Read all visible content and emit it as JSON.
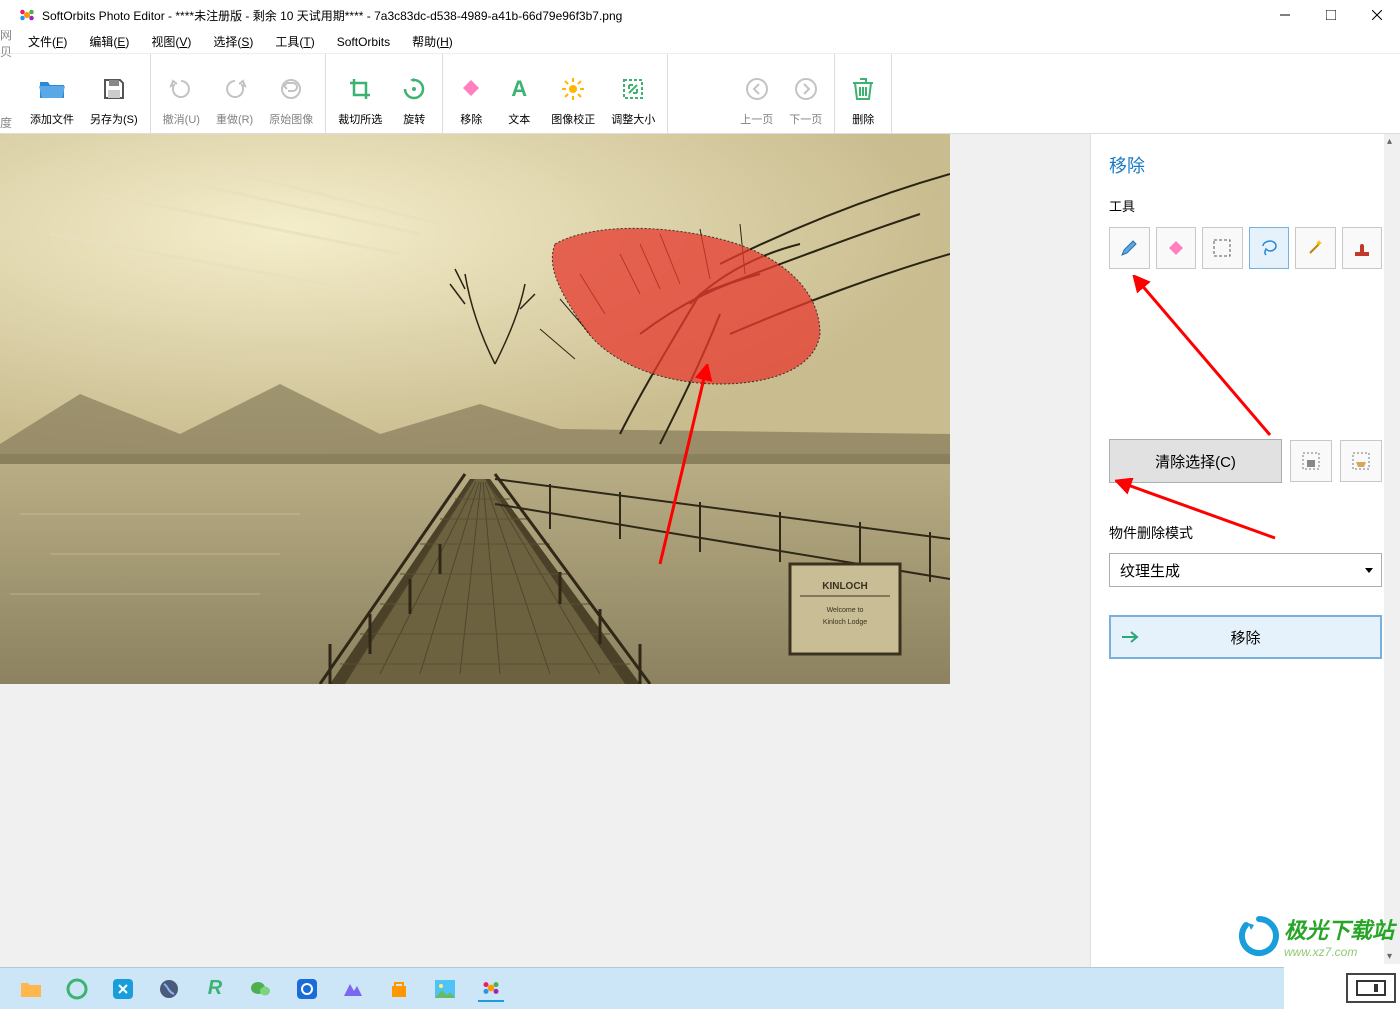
{
  "title": "SoftOrbits Photo Editor - ****未注册版 - 剩余 10 天试用期**** - 7a3c83dc-d538-4989-a41b-66d79e96f3b7.png",
  "menubar": [
    {
      "label": "文件(",
      "accel": "F",
      "suffix": ")"
    },
    {
      "label": "编辑(",
      "accel": "E",
      "suffix": ")"
    },
    {
      "label": "视图(",
      "accel": "V",
      "suffix": ")"
    },
    {
      "label": "选择(",
      "accel": "S",
      "suffix": ")"
    },
    {
      "label": "工具(",
      "accel": "T",
      "suffix": ")"
    },
    {
      "label": "SoftOrbits",
      "accel": "",
      "suffix": ""
    },
    {
      "label": "帮助(",
      "accel": "H",
      "suffix": ")"
    }
  ],
  "toolbar": {
    "add_files": "添加文件",
    "save_as": "另存为(S)",
    "undo": "撤消(U)",
    "redo": "重做(R)",
    "original": "原始图像",
    "crop": "裁切所选",
    "rotate": "旋转",
    "remove": "移除",
    "text": "文本",
    "correction": "图像校正",
    "resize": "调整大小",
    "prev": "上一页",
    "next": "下一页",
    "delete": "删除"
  },
  "panel": {
    "title": "移除",
    "tools_label": "工具",
    "clear_selection": "清除选择(C)",
    "mode_label": "物件删除模式",
    "mode_value": "纹理生成",
    "remove": "移除"
  },
  "watermark": {
    "text": "极光下载站",
    "url": "www.xz7.com"
  },
  "left_edge": {
    "t1": "网贝",
    "t2": "度"
  }
}
